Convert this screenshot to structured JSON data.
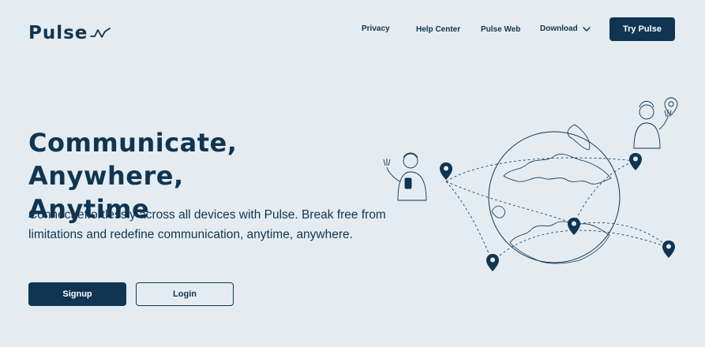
{
  "brand": {
    "name": "Pulse",
    "accent_color": "#0f3552",
    "logo_icon": "pulse-line-icon"
  },
  "nav": {
    "links": [
      {
        "label": "Privacy"
      },
      {
        "label": "Help Center"
      },
      {
        "label": "Pulse Web"
      },
      {
        "label": "Download",
        "icon": "chevron-down-icon"
      }
    ],
    "cta_label": "Try Pulse"
  },
  "hero": {
    "title_line1": "Communicate, Anywhere,",
    "title_line2": "Anytime",
    "subtitle": "Connect effortlessly across all devices with Pulse. Break free from limitations and redefine communication, anytime, anywhere.",
    "primary_button": "Signup",
    "secondary_button": "Login"
  },
  "illustration": {
    "icons": [
      "globe-icon",
      "map-pin-icon",
      "person-with-phone-icon",
      "person-waving-icon"
    ]
  }
}
